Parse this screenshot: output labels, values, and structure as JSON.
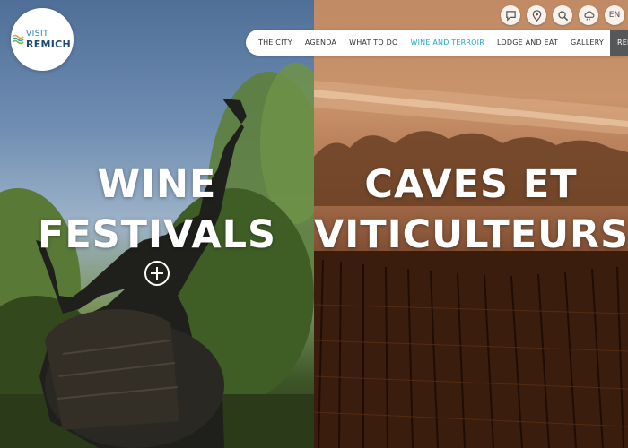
{
  "logo": {
    "line1": "VISIT",
    "line2": "REMICH"
  },
  "top_icons": [
    {
      "name": "chat-icon"
    },
    {
      "name": "map-pin-icon"
    },
    {
      "name": "search-icon"
    },
    {
      "name": "weather-icon"
    },
    {
      "name": "language-selector",
      "label": "EN"
    }
  ],
  "nav": {
    "items": [
      {
        "label": "THE CITY",
        "active": false
      },
      {
        "label": "AGENDA",
        "active": false
      },
      {
        "label": "WHAT TO DO",
        "active": false
      },
      {
        "label": "WINE AND TERROIR",
        "active": true
      },
      {
        "label": "LODGE AND EAT",
        "active": false
      },
      {
        "label": "GALLERY",
        "active": false
      }
    ],
    "external": "REMICH.LU"
  },
  "panels": {
    "left": {
      "line1": "WINE",
      "line2": "FESTIVALS"
    },
    "right": {
      "line1": "CAVES ET",
      "line2": "VITICULTEURS"
    }
  },
  "colors": {
    "accent": "#23a6c7",
    "nav_dark": "#555759",
    "logo_blue": "#1c4a74"
  }
}
